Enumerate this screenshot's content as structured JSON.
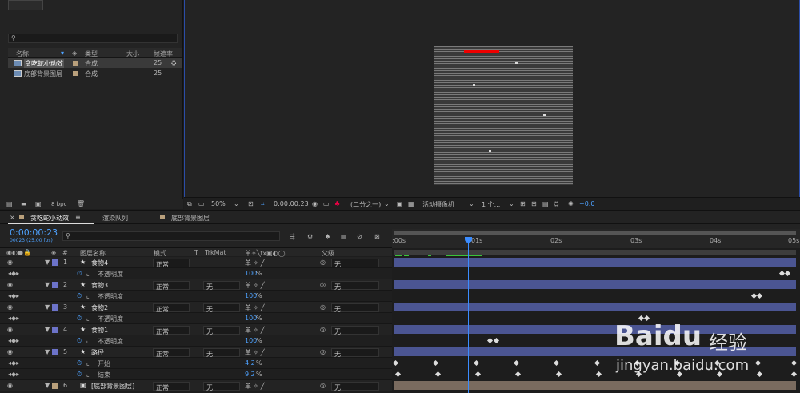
{
  "project": {
    "search_placeholder": "",
    "columns": [
      "名称",
      "类型",
      "大小",
      "帧速率"
    ],
    "items": [
      {
        "name": "贪吃蛇小动效",
        "type": "合成",
        "fps": "25",
        "color": "#b9a07c"
      },
      {
        "name": "底部背景图层",
        "type": "合成",
        "fps": "25",
        "color": "#b9a07c"
      }
    ],
    "bpc": "8 bpc"
  },
  "viewer": {
    "zoom": "50%",
    "timecode": "0:00:00:23",
    "resolution": "(二分之一)",
    "camera": "活动摄像机",
    "views": "1 个...",
    "exposure": "+0.0"
  },
  "timeline": {
    "tabs": [
      "贪吃蛇小动效",
      "渲染队列",
      "底部背景图层"
    ],
    "timecode": "0:00:00:23",
    "timecode_sub": "00023 (25.00 fps)",
    "columns": {
      "num": "#",
      "name": "图层名称",
      "mode": "模式",
      "t": "T",
      "trkmat": "TrkMat",
      "parent": "父级"
    },
    "ruler": [
      ":00s",
      "01s",
      "02s",
      "03s",
      "04s",
      "05s"
    ],
    "layers": [
      {
        "num": "1",
        "name": "食物4",
        "mode": "正常",
        "trkmat": "",
        "parent": "无",
        "color": "#6c73c9",
        "prop": "不透明度",
        "value": "100",
        "unit": "%",
        "kf": [
          0.96,
          0.975
        ]
      },
      {
        "num": "2",
        "name": "食物3",
        "mode": "正常",
        "trkmat": "无",
        "parent": "无",
        "color": "#6c73c9",
        "prop": "不透明度",
        "value": "100",
        "unit": "%",
        "kf": [
          0.89,
          0.905
        ]
      },
      {
        "num": "3",
        "name": "食物2",
        "mode": "正常",
        "trkmat": "无",
        "parent": "无",
        "color": "#6c73c9",
        "prop": "不透明度",
        "value": "100",
        "unit": "%",
        "kf": [
          0.61,
          0.625
        ]
      },
      {
        "num": "4",
        "name": "食物1",
        "mode": "正常",
        "trkmat": "无",
        "parent": "无",
        "color": "#6c73c9",
        "prop": "不透明度",
        "value": "100",
        "unit": "%",
        "kf": [
          0.235,
          0.25
        ]
      }
    ],
    "path_layer": {
      "num": "5",
      "name": "路径",
      "mode": "正常",
      "trkmat": "无",
      "parent": "无",
      "color": "#6c73c9",
      "props": [
        {
          "name": "开始",
          "value": "4.2",
          "unit": "%"
        },
        {
          "name": "结束",
          "value": "9.2",
          "unit": "%"
        }
      ]
    },
    "bg_layer": {
      "num": "6",
      "name": "[底部背景图层]",
      "mode": "正常",
      "trkmat": "无",
      "parent": "无",
      "color": "#b9a07c"
    }
  },
  "watermark": {
    "brand": "Baidu",
    "brand_cn": "经验",
    "url": "jingyan.baidu.com"
  }
}
